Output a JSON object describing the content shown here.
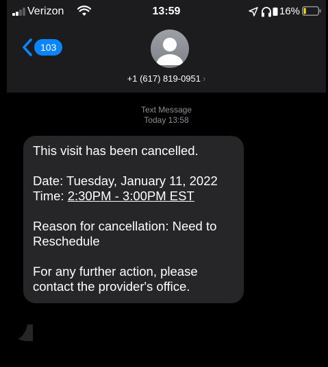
{
  "status_bar": {
    "carrier": "Verizon",
    "time": "13:59",
    "battery_percent": "16%",
    "icons": [
      "signal-icon",
      "wifi-icon",
      "location-arrow-icon",
      "headphones-icon",
      "orientation-lock-icon",
      "battery-icon"
    ],
    "battery_level": 0.16,
    "battery_color": "#ffd60a"
  },
  "header": {
    "back_count": "103",
    "contact_number": "+1 (617) 819-0951",
    "contact_chevron": "›",
    "accent_color": "#0a84ff"
  },
  "thread": {
    "service_label": "Text Message",
    "timestamp": "Today 13:58",
    "message": {
      "line1": "This visit has been cancelled.",
      "date": "Date: Tuesday, January 11, 2022",
      "time_prefix": "Time: ",
      "time_value": "2:30PM - 3:00PM EST",
      "reason": "Reason for cancellation: Need to Reschedule",
      "action": "For any further action, please contact the provider's office."
    }
  }
}
